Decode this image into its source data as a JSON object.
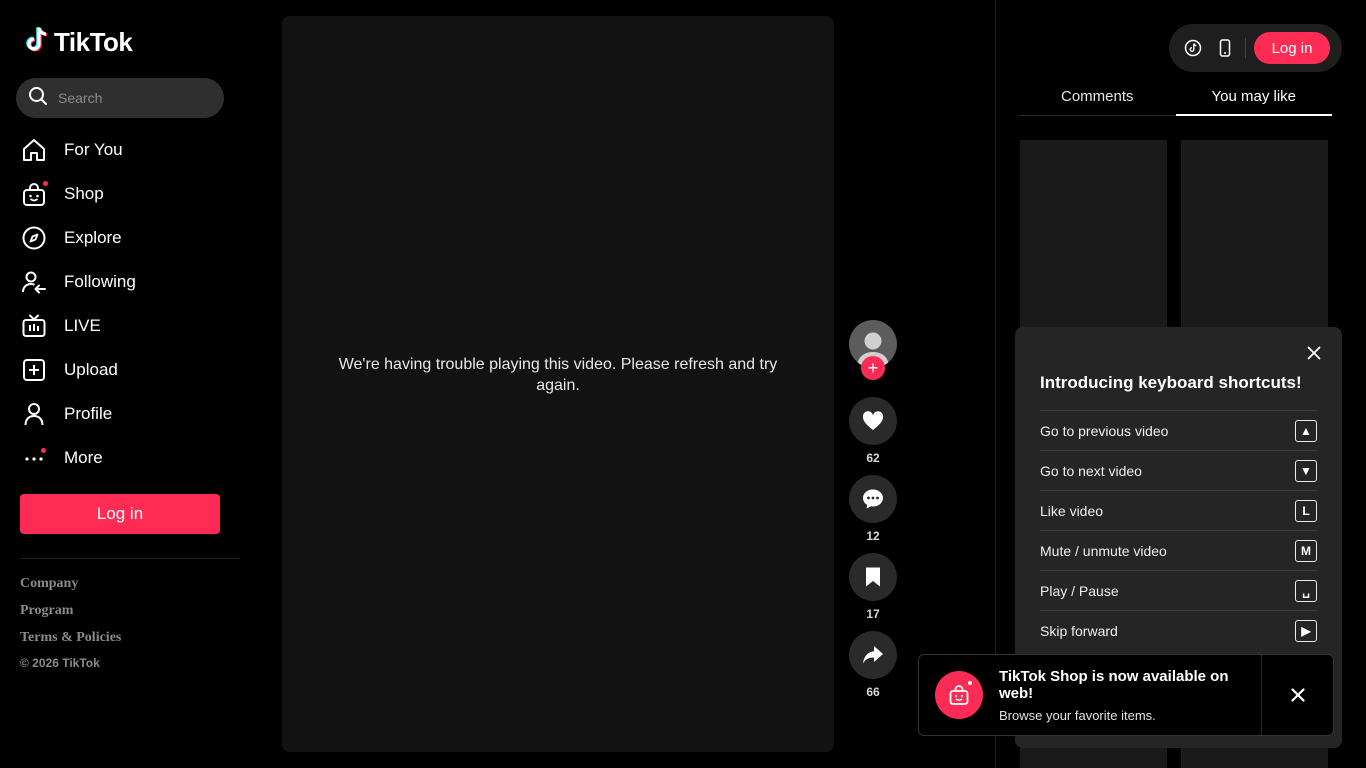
{
  "brand": {
    "name": "TikTok",
    "accent": "#fe2c55"
  },
  "search": {
    "placeholder": "Search"
  },
  "nav": [
    {
      "label": "For You",
      "icon": "home-icon"
    },
    {
      "label": "Shop",
      "icon": "shopping-bag-icon"
    },
    {
      "label": "Explore",
      "icon": "compass-icon"
    },
    {
      "label": "Following",
      "icon": "following-icon"
    },
    {
      "label": "LIVE",
      "icon": "live-tv-icon"
    },
    {
      "label": "Upload",
      "icon": "upload-plus-icon"
    },
    {
      "label": "Profile",
      "icon": "person-icon"
    },
    {
      "label": "More",
      "icon": "more-dots-icon"
    }
  ],
  "sidebar": {
    "login_label": "Log in",
    "footer": [
      "Company",
      "Program",
      "Terms & Policies"
    ],
    "copyright": "© 2026 TikTok"
  },
  "video": {
    "message": "We're having trouble playing this video. Please refresh and try again."
  },
  "actions": {
    "likes": "62",
    "comments": "12",
    "saves": "17",
    "shares": "66",
    "follow": "+"
  },
  "topbar": {
    "login_label": "Log in"
  },
  "tabs": [
    {
      "label": "Comments"
    },
    {
      "label": "You may like"
    }
  ],
  "shortcuts": {
    "title": "Introducing keyboard shortcuts!",
    "items": [
      {
        "label": "Go to previous video",
        "key": "▲"
      },
      {
        "label": "Go to next video",
        "key": "▼"
      },
      {
        "label": "Like video",
        "key": "L"
      },
      {
        "label": "Mute / unmute video",
        "key": "M"
      },
      {
        "label": "Play / Pause",
        "key": "␣"
      },
      {
        "label": "Skip forward",
        "key": "▶"
      }
    ]
  },
  "toast": {
    "title": "TikTok Shop is now available on web!",
    "subtitle": "Browse your favorite items."
  }
}
